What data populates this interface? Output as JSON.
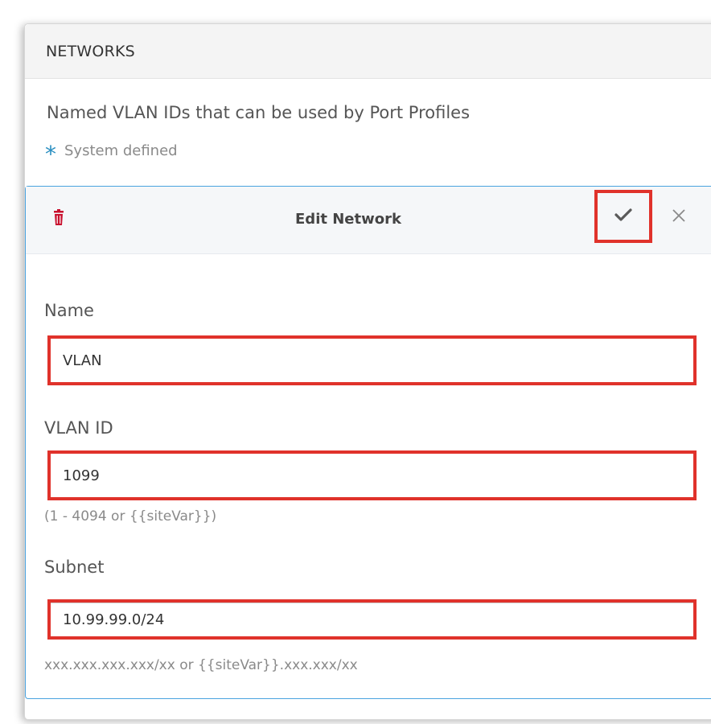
{
  "panel": {
    "title": "NETWORKS",
    "description": "Named VLAN IDs that can be used by Port Profiles",
    "legend_symbol": "*",
    "legend_text": "System defined"
  },
  "edit": {
    "title": "Edit Network",
    "icons": {
      "delete": "trash-icon",
      "confirm": "checkmark-icon",
      "close": "close-icon"
    }
  },
  "fields": {
    "name": {
      "label": "Name",
      "value": "VLAN"
    },
    "vlan_id": {
      "label": "VLAN ID",
      "value": "1099",
      "hint": "(1 - 4094 or {{siteVar}})"
    },
    "subnet": {
      "label": "Subnet",
      "value": "10.99.99.0/24",
      "hint": "xxx.xxx.xxx.xxx/xx or {{siteVar}}.xxx.xxx/xx"
    }
  },
  "colors": {
    "highlight": "#e0322b",
    "accent_blue": "#2a8fc1",
    "trash_red": "#c8102e"
  }
}
